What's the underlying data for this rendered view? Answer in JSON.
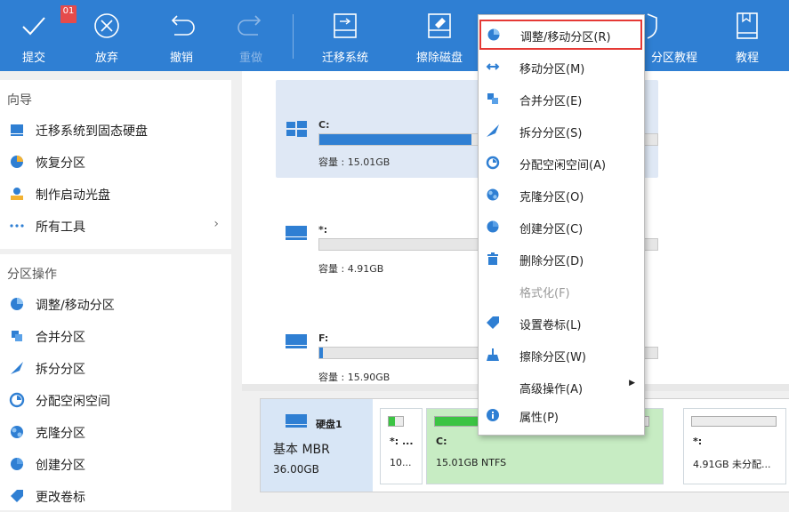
{
  "toolbar": {
    "badge": "01",
    "items": [
      {
        "label": "提交"
      },
      {
        "label": "放弃"
      },
      {
        "label": "撤销"
      },
      {
        "label": "重做"
      },
      {
        "label": "迁移系统"
      },
      {
        "label": "擦除磁盘"
      },
      {
        "label": "分区教程"
      },
      {
        "label": "教程"
      }
    ]
  },
  "sidebar": {
    "guide_title": "向导",
    "guide_items": [
      {
        "label": "迁移系统到固态硬盘",
        "icon": "migrate-icon"
      },
      {
        "label": "恢复分区",
        "icon": "recover-icon"
      },
      {
        "label": "制作启动光盘",
        "icon": "bootdisk-icon"
      },
      {
        "label": "所有工具",
        "icon": "more-icon"
      }
    ],
    "ops_title": "分区操作",
    "ops_items": [
      {
        "label": "调整/移动分区",
        "icon": "resize-icon"
      },
      {
        "label": "合并分区",
        "icon": "merge-icon"
      },
      {
        "label": "拆分分区",
        "icon": "split-icon"
      },
      {
        "label": "分配空闲空间",
        "icon": "allocate-icon"
      },
      {
        "label": "克隆分区",
        "icon": "clone-icon"
      },
      {
        "label": "创建分区",
        "icon": "create-icon"
      },
      {
        "label": "更改卷标",
        "icon": "label-icon"
      }
    ]
  },
  "partitions": [
    {
      "name": "C:",
      "capacity": "容量 : 15.01GB",
      "fill": 0.45
    },
    {
      "name": "*:",
      "capacity": "容量 : 4.91GB",
      "fill": 0.0
    },
    {
      "name": "F:",
      "capacity": "容量 : 15.90GB",
      "fill": 0.01
    }
  ],
  "disk": {
    "name": "硬盘1",
    "type": "基本 MBR",
    "size": "36.00GB",
    "parts": [
      {
        "name": "*: ...",
        "info": "10..."
      },
      {
        "name": "C:",
        "info": "15.01GB NTFS"
      },
      {
        "name": "*:",
        "info": "4.91GB 未分配..."
      }
    ]
  },
  "menu": {
    "items": [
      {
        "label": "调整/移动分区(R)"
      },
      {
        "label": "移动分区(M)"
      },
      {
        "label": "合并分区(E)"
      },
      {
        "label": "拆分分区(S)"
      },
      {
        "label": "分配空闲空间(A)"
      },
      {
        "label": "克隆分区(O)"
      },
      {
        "label": "创建分区(C)"
      },
      {
        "label": "删除分区(D)"
      },
      {
        "label": "格式化(F)"
      },
      {
        "label": "设置卷标(L)"
      },
      {
        "label": "擦除分区(W)"
      },
      {
        "label": "高级操作(A)"
      },
      {
        "label": "属性(P)"
      }
    ]
  },
  "colors": {
    "toolbar": "#2f7fd3",
    "accent": "#2f7fd3",
    "highlight": "#e53935",
    "used": "#3bc443"
  }
}
